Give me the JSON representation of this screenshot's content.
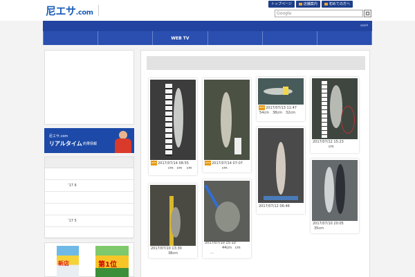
{
  "header": {
    "logo": "尼エサ",
    "logo_suffix": ".com",
    "toplinks": [
      "トップページ",
      "店舗案内",
      "初めての方へ"
    ],
    "search_placeholder": "Google"
  },
  "nav": {
    "small_text": "sarch",
    "tabs": [
      "",
      "",
      "WEB TV",
      "",
      "",
      ""
    ]
  },
  "sidebar": {
    "banner": {
      "small": "尼エサ.com",
      "big": "リアルタイム",
      "sub": "釣果情報"
    },
    "archive": [
      "",
      "’17 6",
      "",
      "",
      "’17 5",
      ""
    ]
  },
  "colors": {
    "brand_blue": "#1d5fb8",
    "nav_blue": "#2244a0",
    "badge_orange": "#e59a14"
  },
  "posts": [
    {
      "badge": "NEW",
      "date": "2017/07/14 08:55",
      "text": "cm　cm　 cm"
    },
    {
      "badge": "NEW",
      "date": "2017/07/14 07:07",
      "text": "cm"
    },
    {
      "badge": "NEW",
      "date": "2017/07/13 11:47",
      "text": "54cm　38cm　32cm"
    },
    {
      "badge": "",
      "date": "2017/07/12 15:23",
      "text": "cm"
    },
    {
      "badge": "",
      "date": "2017/07/12 06:46",
      "text": ""
    },
    {
      "badge": "",
      "date": "2017/07/10 20:05",
      "text": "35cm"
    },
    {
      "badge": "",
      "date": "2017/07/10 13:30",
      "text": "38cm"
    },
    {
      "badge": "",
      "date": "2017/07/10 15:10",
      "text": "44cm　cm"
    }
  ]
}
